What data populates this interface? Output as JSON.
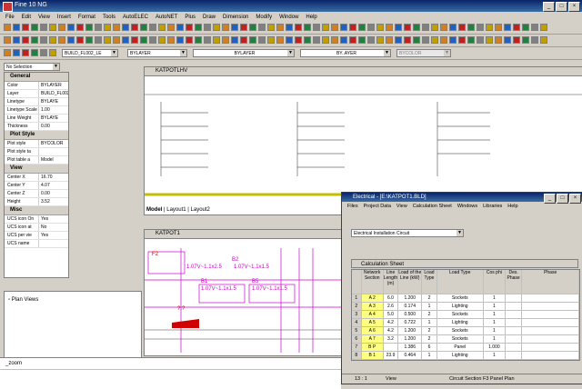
{
  "app": {
    "title": "Fine 10 NG"
  },
  "menu": [
    "File",
    "Edit",
    "View",
    "Insert",
    "Format",
    "Tools",
    "AutoELEC",
    "AutoNET",
    "Plus",
    "Draw",
    "Dimension",
    "Modify",
    "Window",
    "Help"
  ],
  "toolbar": {
    "layer_value": "BUILD_FL002_LE",
    "color_value": "BYLAYER",
    "linetype_value": "BYLAYER",
    "lineweight_value": "BY..AYER",
    "plotstyle_value": "BYCOLOR"
  },
  "properties": {
    "selection": "No Selection",
    "sections": [
      {
        "title": "General",
        "rows": [
          [
            "Color",
            "BYLAYER"
          ],
          [
            "Layer",
            "BUILD_FL002_L"
          ],
          [
            "Linetype",
            "BYLAYE"
          ],
          [
            "Linetype Scale",
            "1.00"
          ],
          [
            "Line Weight",
            "BYLAYE"
          ],
          [
            "Thickness",
            "0.00"
          ]
        ]
      },
      {
        "title": "Plot Style",
        "rows": [
          [
            "Plot style",
            "BYCOLOR"
          ],
          [
            "Plot style ta",
            ""
          ],
          [
            "Plot table a",
            "Model"
          ]
        ]
      },
      {
        "title": "View",
        "rows": [
          [
            "Center X",
            "16.70"
          ],
          [
            "Center Y",
            "4.07"
          ],
          [
            "Center Z",
            "0.00"
          ],
          [
            "Height",
            "3.52"
          ]
        ]
      },
      {
        "title": "Misc",
        "rows": [
          [
            "UCS icon On",
            "Yes"
          ],
          [
            "UCS icon at",
            "No"
          ],
          [
            "UCS per vie",
            "Yes"
          ],
          [
            "UCS name",
            ""
          ]
        ]
      }
    ]
  },
  "plan_views": {
    "label": "Plan Views"
  },
  "drawing_top": {
    "title": "KATPOTLHV",
    "tabs": [
      "Model",
      "Layout1",
      "Layout2"
    ]
  },
  "drawing_bottom": {
    "title": "KATPOT1",
    "labels": [
      "F2",
      "1.07V~1.1x2.5",
      "B2",
      "1.07V~1.1x1.5",
      "B1",
      "1.07V~1.1x1.5",
      "B5",
      "1.07V~1.1x1.5",
      "?.?"
    ]
  },
  "command": {
    "line1": "_zoom",
    "line2": ""
  },
  "electrical": {
    "title": "Electrical - [E:\\KATPOT1.BLD]",
    "menu": [
      "Files",
      "Project Data",
      "View",
      "Calculation Sheet",
      "Windows",
      "Libraries",
      "Help"
    ],
    "circuit_label": "Electrical Installation Circuit",
    "sheet_title": "Calculation Sheet",
    "headers": [
      "Network Section",
      "Line Length (m)",
      "Load of the Line (kW)",
      "Load Type",
      "Load Type",
      "Cos phi",
      "Des. Phase",
      "Phase"
    ],
    "rows": [
      [
        "1",
        "A 2",
        "6.0",
        "1.200",
        "2",
        "Sockets",
        "1",
        "",
        ""
      ],
      [
        "2",
        "A 3",
        "2.6",
        "0.174",
        "1",
        "Lighting",
        "1",
        "",
        ""
      ],
      [
        "3",
        "A 4",
        "5.0",
        "0.500",
        "2",
        "Sockets",
        "1",
        "",
        ""
      ],
      [
        "4",
        "A 5",
        "4.2",
        "0.722",
        "1",
        "Lighting",
        "1",
        "",
        ""
      ],
      [
        "5",
        "A 6",
        "4.2",
        "1.200",
        "2",
        "Sockets",
        "1",
        "",
        ""
      ],
      [
        "6",
        "A 7",
        "3.2",
        "1.200",
        "2",
        "Sockets",
        "1",
        "",
        ""
      ],
      [
        "7",
        "B P",
        "",
        "1.386",
        "6",
        "Panel",
        "1.000",
        "",
        ""
      ],
      [
        "8",
        "B 1",
        "23.9",
        "0.464",
        "1",
        "Lighting",
        "1",
        "",
        ""
      ]
    ],
    "status_left": "13 : 1",
    "status_mid": "View",
    "status_right": "Circuit Section F3 Panel Plan"
  }
}
